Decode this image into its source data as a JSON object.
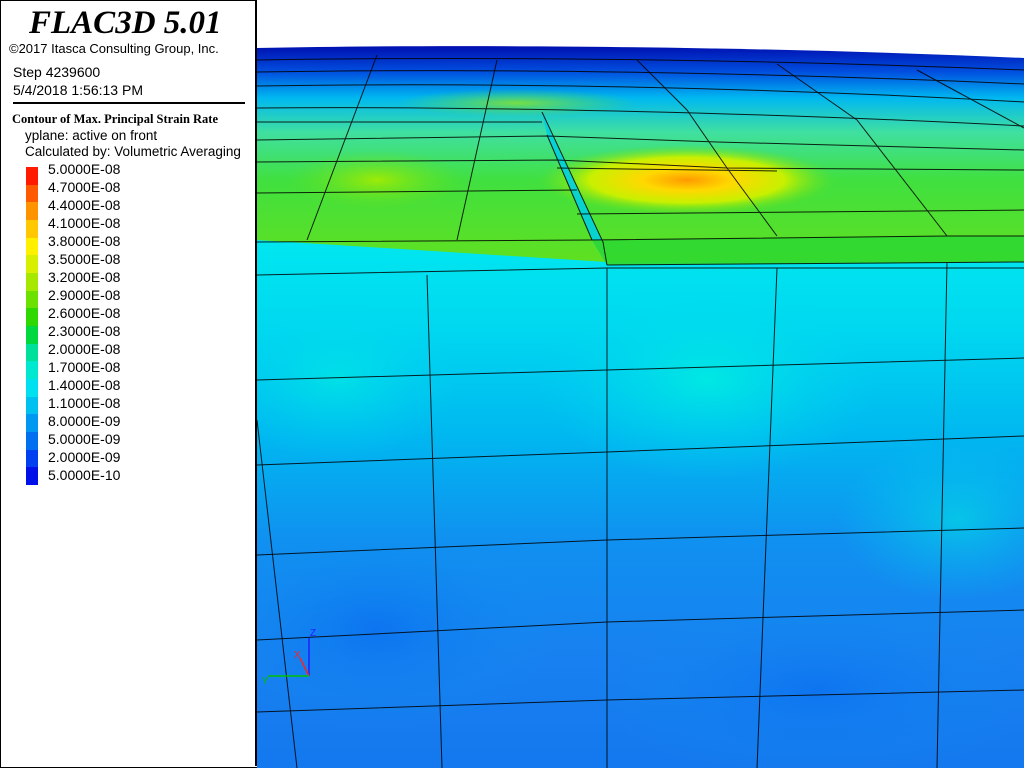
{
  "header": {
    "app_title": "FLAC3D 5.01",
    "copyright": "©2017 Itasca Consulting Group, Inc.",
    "step": "Step 4239600",
    "datetime": "5/4/2018 1:56:13 PM"
  },
  "legend": {
    "title": "Contour of Max. Principal Strain Rate",
    "plane": "yplane: active on front",
    "calculated_by": "Calculated by: Volumetric Averaging",
    "entries": [
      {
        "label": "5.0000E-08",
        "color": "#ff1a00"
      },
      {
        "label": "4.7000E-08",
        "color": "#ff5a00"
      },
      {
        "label": "4.4000E-08",
        "color": "#ff9400"
      },
      {
        "label": "4.1000E-08",
        "color": "#ffc800"
      },
      {
        "label": "3.8000E-08",
        "color": "#fff000"
      },
      {
        "label": "3.5000E-08",
        "color": "#d8f000"
      },
      {
        "label": "3.2000E-08",
        "color": "#a6e800"
      },
      {
        "label": "2.9000E-08",
        "color": "#6ce000"
      },
      {
        "label": "2.6000E-08",
        "color": "#2ed800"
      },
      {
        "label": "2.3000E-08",
        "color": "#00d840"
      },
      {
        "label": "2.0000E-08",
        "color": "#00e09a"
      },
      {
        "label": "1.7000E-08",
        "color": "#00e8d0"
      },
      {
        "label": "1.4000E-08",
        "color": "#00e0f0"
      },
      {
        "label": "1.1000E-08",
        "color": "#00c0f0"
      },
      {
        "label": "8.0000E-09",
        "color": "#0098f0"
      },
      {
        "label": "5.0000E-09",
        "color": "#0070f0"
      },
      {
        "label": "2.0000E-09",
        "color": "#0040f0"
      },
      {
        "label": "5.0000E-10",
        "color": "#0010e8"
      }
    ]
  },
  "axes": {
    "z_label": "Z",
    "x_label": "X",
    "y_label": "Y",
    "z_color": "#2020ff",
    "x_color": "#ff2020",
    "y_color": "#00c000"
  }
}
